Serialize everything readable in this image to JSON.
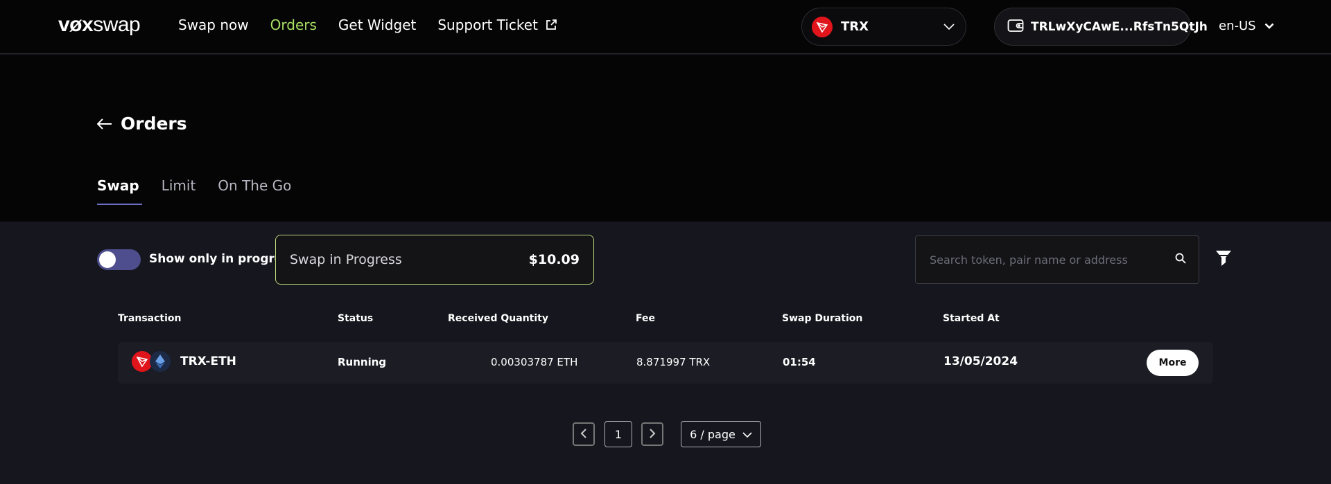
{
  "header": {
    "logo": {
      "part1": "vøx",
      "part2": "swap"
    },
    "nav": [
      {
        "label": "Swap now",
        "active": false
      },
      {
        "label": "Orders",
        "active": true
      },
      {
        "label": "Get Widget",
        "active": false
      },
      {
        "label": "Support Ticket",
        "active": false,
        "external": true
      }
    ],
    "chain": {
      "label": "TRX",
      "icon": "tron-icon"
    },
    "wallet": {
      "address": "TRLwXyCAwE...RfsTn5QtJh",
      "icon": "wallet-icon"
    },
    "language": "en-US"
  },
  "page": {
    "title": "Orders",
    "tabs": [
      {
        "label": "Swap",
        "active": true
      },
      {
        "label": "Limit",
        "active": false
      },
      {
        "label": "On The Go",
        "active": false
      }
    ]
  },
  "controls": {
    "toggle_label": "Show only in progress",
    "toggle_on": false,
    "progress_label": "Swap in Progress",
    "progress_amount": "$10.09",
    "search_placeholder": "Search token, pair name or address"
  },
  "table": {
    "columns": [
      "Transaction",
      "Status",
      "Received Quantity",
      "Fee",
      "Swap Duration",
      "Started At"
    ],
    "rows": [
      {
        "pair": "TRX-ETH",
        "status": "Running",
        "received": "0.00303787 ETH",
        "fee": "8.871997 TRX",
        "duration": "01:54",
        "started": "13/05/2024",
        "action": "More"
      }
    ]
  },
  "pagination": {
    "current_page": "1",
    "page_size": "6 / page"
  },
  "colors": {
    "accent_green": "#a8e063",
    "tab_underline": "#6d6fc2",
    "tron_red": "#e0141b"
  }
}
